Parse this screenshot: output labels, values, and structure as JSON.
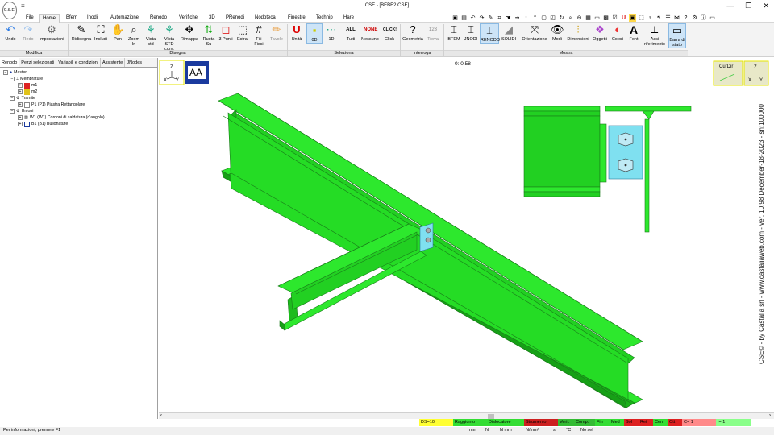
{
  "window": {
    "title": "CSE - [BEBE2.CSE]",
    "logo_text": "C.S.E.",
    "quick_access_text": "≡",
    "minimize": "—",
    "restore": "❐",
    "close": "✕"
  },
  "menu": {
    "tabs": [
      "File",
      "Home",
      "Bfem",
      "Inodi",
      "Automazione",
      "Renodo",
      "Verifiche",
      "3D",
      "PRenodi",
      "Nodoteca",
      "Finestre",
      "Technip",
      "Hare"
    ],
    "active_tab": "Home"
  },
  "ribbon": {
    "buttons": {
      "undo": "Undo",
      "redo": "Redo",
      "settings": "Impostazioni",
      "redraw": "Ridisegna",
      "include": "Includi",
      "pan": "Pan",
      "zoom": "Zoom In",
      "view_std": "Vista std",
      "view_std_com": "Vista STD com.",
      "remap": "Rimappa",
      "rotate": "Ruota Su",
      "three_points": "3 Punti",
      "extract": "Estrai",
      "wires": "Fili Fissi",
      "tables": "Tavole",
      "units": "Unità",
      "zero_d": "0D",
      "one_d": "1D",
      "all": "Tutti",
      "none": "Nessuno",
      "click": "Click",
      "geometry": "Geometria",
      "find": "Trova",
      "bfem": "BFEM",
      "jnodi": "JNODI",
      "renodo": "RENODO",
      "solidi": "SOLIDI",
      "orientation": "Orientazione",
      "modes": "Modi",
      "dimensions": "Dimensioni",
      "objects": "Oggetti",
      "colors": "Colori",
      "font": "Font",
      "axes": "Assi riferimento",
      "statusbar": "Barra di stato"
    },
    "icon_labels": {
      "all": "ALL",
      "none": "NONE",
      "click": "CLICK!",
      "find_num": "123",
      "font_letter": "A"
    },
    "groups": {
      "modifica": "Modifica",
      "disegna": "Disegna",
      "seleziona": "Seleziona",
      "interroga": "Interroga",
      "mostra": "Mostra"
    }
  },
  "left_panel": {
    "tabs": [
      "Renodo",
      "Pezzi selezionati",
      "Variabili e condizioni",
      "Assistente",
      "JNodes"
    ],
    "active_tab": "Renodo",
    "tree": {
      "root": "Master",
      "membrature": "Membrature",
      "m1": "m1",
      "m2": "m2",
      "tramite": "Tramite",
      "p1": "P1 (P1)  Piastra Rettangolare",
      "unioni": "Unioni",
      "w1": "W1 (W1)  Cordoni di saldatura (d'angolo)",
      "b1": "B1 (B1)  Bullonature"
    }
  },
  "viewport": {
    "axis_z": "Z",
    "axis_x": "X",
    "axis_y": "Y",
    "aa_label": "AA",
    "timer": "0: 0.58",
    "curdir_label": "CurDir",
    "vertical_watermark": "CSE© - by Castalia srl - www.castaliaweb.com - ver. 10.98 December-18-2023 - sn:100000"
  },
  "status": {
    "row1": [
      "DS=10",
      "Raggiunto",
      "Dislocatore",
      "Strumento",
      "Verif.",
      "Comp.",
      "Fin",
      "Med",
      "Sol",
      "Ret",
      "Cen",
      "Ott",
      "C= 1",
      "I= 1"
    ],
    "row2_left": "Per informazioni, premere F1",
    "units": [
      "mm",
      "N",
      "N mm",
      "N/mm²",
      "s",
      "°C",
      "No sel"
    ]
  },
  "colors": {
    "member_green": "#22e022",
    "plate_cyan": "#7fe0f0",
    "selected_blue": "#cde4f7",
    "aa_bg": "#1a3a9e"
  }
}
